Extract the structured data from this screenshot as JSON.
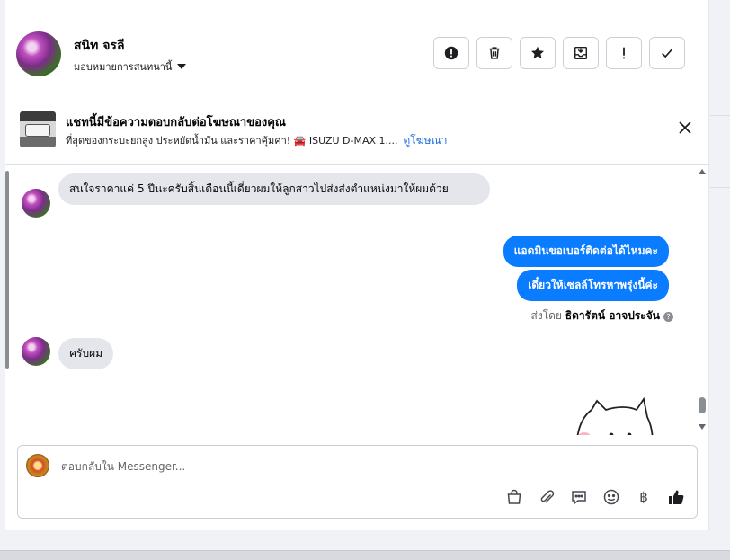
{
  "header": {
    "contact_name": "สนิท จรลี",
    "assign_label": "มอบหมายการสนทนานี้"
  },
  "actions": [
    {
      "name": "report-icon"
    },
    {
      "name": "trash-icon"
    },
    {
      "name": "star-icon"
    },
    {
      "name": "move-to-inbox-icon"
    },
    {
      "name": "important-icon"
    },
    {
      "name": "check-icon"
    }
  ],
  "ad": {
    "title": "แชทนี้มีข้อความตอบกลับต่อโฆษณาของคุณ",
    "subtitle": "ที่สุดของกระบะยกสูง ประหยัดน้ำมัน และราคาคุ้มค่า! 🚘 ISUZU D-MAX 1....",
    "link": "ดูโฆษณา"
  },
  "messages": {
    "m1": "สนใจราคาแค่ 5 ปีนะครับสิ้นเดือนนี้เดี๋ยวผมให้ลูกสาวไปส่งส่งตำแหน่งมาให้ผมด้วย",
    "m2": "แอดมินขอเบอร์ติดต่อได้ไหมคะ",
    "m3": "เดี๋ยวให้เซลล์โทรหาพรุ่งนี้ค่ะ",
    "sent_by_prefix": "ส่งโดย",
    "sent_by_name": "ธิดารัตน์ อาจประจัน",
    "m4": "ครับผม"
  },
  "composer": {
    "placeholder": "ตอบกลับใน Messenger...",
    "baht_symbol": "฿"
  },
  "colors": {
    "outgoing_bubble": "#0a7cff",
    "incoming_bubble": "#e4e6eb",
    "link": "#216fdb"
  }
}
